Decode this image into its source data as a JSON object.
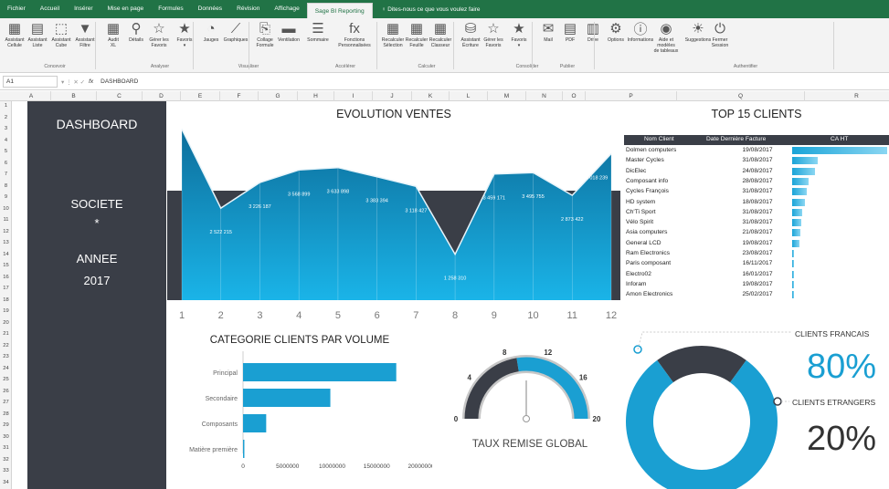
{
  "menu": {
    "items": [
      "Fichier",
      "Accueil",
      "Insérer",
      "Mise en page",
      "Formules",
      "Données",
      "Révision",
      "Affichage",
      "Sage BI Reporting"
    ],
    "active_index": 8,
    "tell_me": "Dites-nous ce que vous voulez faire"
  },
  "ribbon": {
    "buttons": [
      {
        "label": "Assistant\nCellule",
        "icon": "cell-wizard-icon",
        "glyph": "▦"
      },
      {
        "label": "Assistant\nListe",
        "icon": "list-wizard-icon",
        "glyph": "▤"
      },
      {
        "label": "Assistant\nCube",
        "icon": "cube-wizard-icon",
        "glyph": "⬚"
      },
      {
        "label": "Assistant\nFiltre",
        "icon": "filter-icon",
        "glyph": "▼"
      },
      {
        "label": "Audit\nXL",
        "icon": "audit-icon",
        "glyph": "▦"
      },
      {
        "label": "Détails",
        "icon": "details-icon",
        "glyph": "⚲"
      },
      {
        "label": "Gérer les\nFavoris",
        "icon": "manage-favorites-icon",
        "glyph": "☆"
      },
      {
        "label": "Favoris\n▾",
        "icon": "favorites-icon",
        "glyph": "★"
      },
      {
        "label": "Jauges",
        "icon": "gauge-icon",
        "glyph": "◔"
      },
      {
        "label": "Graphiques",
        "icon": "chart-icon",
        "glyph": "⟋"
      },
      {
        "label": "Collage\nFormule",
        "icon": "paste-formula-icon",
        "glyph": "⎘"
      },
      {
        "label": "Ventilation",
        "icon": "breakdown-icon",
        "glyph": "▬"
      },
      {
        "label": "Sommaire",
        "icon": "summary-icon",
        "glyph": "☰"
      },
      {
        "label": "Fonctions\nPersonnalisées",
        "icon": "functions-icon",
        "glyph": "fx"
      },
      {
        "label": "Recalculer\nSélection",
        "icon": "recalc-selection-icon",
        "glyph": "▦"
      },
      {
        "label": "Recalculer\nFeuille",
        "icon": "recalc-sheet-icon",
        "glyph": "▦"
      },
      {
        "label": "Recalculer\nClasseur",
        "icon": "recalc-workbook-icon",
        "glyph": "▦"
      },
      {
        "label": "Assistant\nÉcriture",
        "icon": "write-wizard-icon",
        "glyph": "⛁"
      },
      {
        "label": "Gérer les\nFavoris",
        "icon": "manage-favorites-2-icon",
        "glyph": "☆"
      },
      {
        "label": "Favoris\n▾",
        "icon": "favorites-2-icon",
        "glyph": "★"
      },
      {
        "label": "Mail",
        "icon": "mail-icon",
        "glyph": "✉"
      },
      {
        "label": "PDF",
        "icon": "pdf-icon",
        "glyph": "▤"
      },
      {
        "label": "Drive",
        "icon": "drive-icon",
        "glyph": "▥"
      },
      {
        "label": "Options",
        "icon": "options-icon",
        "glyph": "⚙"
      },
      {
        "label": "Informations",
        "icon": "info-icon",
        "glyph": "ⓘ"
      },
      {
        "label": "Aide et modèles\nde tableaux",
        "icon": "help-icon",
        "glyph": "◉"
      },
      {
        "label": "Suggestions",
        "icon": "suggestions-icon",
        "glyph": "☀"
      },
      {
        "label": "Fermer\nSession",
        "icon": "power-icon",
        "glyph": "⏻"
      }
    ],
    "groups": [
      "Concevoir",
      "Analyser",
      "Visualiser",
      "Accélérer",
      "Calculer",
      "Consolider",
      "Publier",
      "Authentifier"
    ]
  },
  "formula_bar": {
    "cell": "A1",
    "fx": "fx",
    "value": "DASHBOARD"
  },
  "columns": [
    "A",
    "B",
    "C",
    "D",
    "E",
    "F",
    "G",
    "H",
    "I",
    "J",
    "K",
    "L",
    "M",
    "N",
    "O",
    "P",
    "Q",
    "R"
  ],
  "rows": [
    "1",
    "2",
    "3",
    "4",
    "5",
    "6",
    "7",
    "8",
    "9",
    "10",
    "11",
    "12",
    "13",
    "14",
    "15",
    "16",
    "17",
    "18",
    "19",
    "20",
    "21",
    "22",
    "23",
    "24",
    "25",
    "26",
    "27",
    "28",
    "29",
    "30",
    "31",
    "32",
    "33",
    "34"
  ],
  "sidebar": {
    "title": "DASHBOARD",
    "societe_label": "SOCIETE",
    "societe_value": "*",
    "annee_label": "ANNEE",
    "annee_value": "2017"
  },
  "evolution": {
    "title": "EVOLUTION VENTES",
    "color": "#1a9fd2"
  },
  "top15": {
    "title": "TOP 15 CLIENTS",
    "headers": [
      "Nom Client",
      "Date Dernière Facture",
      "CA HT"
    ],
    "rows": [
      {
        "name": "Dolmen computers",
        "date": "19/08/2017",
        "ca": 1.0
      },
      {
        "name": "Master Cycles",
        "date": "31/08/2017",
        "ca": 0.27
      },
      {
        "name": "DicElec",
        "date": "24/08/2017",
        "ca": 0.24
      },
      {
        "name": "Composant info",
        "date": "28/08/2017",
        "ca": 0.17
      },
      {
        "name": "Cycles François",
        "date": "31/08/2017",
        "ca": 0.15
      },
      {
        "name": "HD system",
        "date": "18/08/2017",
        "ca": 0.13
      },
      {
        "name": "Ch'Ti Sport",
        "date": "31/08/2017",
        "ca": 0.11
      },
      {
        "name": "Vélo Spirit",
        "date": "31/08/2017",
        "ca": 0.1
      },
      {
        "name": "Asia computers",
        "date": "21/08/2017",
        "ca": 0.09
      },
      {
        "name": "General LCD",
        "date": "19/08/2017",
        "ca": 0.08
      },
      {
        "name": "Ram Electronics",
        "date": "23/08/2017",
        "ca": 0.02
      },
      {
        "name": "Paris composant",
        "date": "16/11/2017",
        "ca": 0.02
      },
      {
        "name": "Electro02",
        "date": "16/01/2017",
        "ca": 0.02
      },
      {
        "name": "Inforam",
        "date": "19/08/2017",
        "ca": 0.02
      },
      {
        "name": "Amon Electronics",
        "date": "25/02/2017",
        "ca": 0.01
      }
    ]
  },
  "categories": {
    "title": "CATEGORIE CLIENTS PAR VOLUME"
  },
  "gauge": {
    "title": "TAUX REMISE GLOBAL",
    "value": 9,
    "min": 0,
    "max": 20,
    "ticks": [
      0,
      4,
      8,
      12,
      16,
      20
    ]
  },
  "donut": {
    "fr_label": "CLIENTS FRANCAIS",
    "fr_pct": "80%",
    "fr_value": 80,
    "et_label": "CLIENTS ETRANGERS",
    "et_pct": "20%",
    "et_value": 20,
    "fr_color": "#1a9fd2",
    "et_color": "#3a3e47"
  },
  "chart_data": [
    {
      "type": "area",
      "title": "EVOLUTION VENTES",
      "categories": [
        "1",
        "2",
        "3",
        "4",
        "5",
        "6",
        "7",
        "8",
        "9",
        "10",
        "11",
        "12"
      ],
      "values": [
        4689875,
        2522215,
        3226187,
        3568899,
        3633898,
        3383394,
        3118427,
        1258310,
        3459171,
        3495755,
        2873422,
        4018239
      ],
      "labels": [
        "4 689 875",
        "2 522 215",
        "3 226 187",
        "3 568 899",
        "3 633 898",
        "3 383 394",
        "3 118 427",
        "1 258 310",
        "3 459 171",
        "3 495 755",
        "2 873 422",
        "4 018 239"
      ],
      "ylim": [
        0,
        5000000
      ]
    },
    {
      "type": "bar",
      "title": "CATEGORIE CLIENTS PAR VOLUME",
      "categories": [
        "Principal",
        "Secondaire",
        "Composants",
        "Matière première"
      ],
      "values": [
        17200000,
        9800000,
        2600000,
        150000
      ],
      "xticks": [
        "0",
        "5000000",
        "10000000",
        "15000000",
        "20000000"
      ],
      "xlim": [
        0,
        20000000
      ]
    },
    {
      "type": "pie",
      "categories": [
        "CLIENTS FRANCAIS",
        "CLIENTS ETRANGERS"
      ],
      "values": [
        80,
        20
      ]
    }
  ]
}
